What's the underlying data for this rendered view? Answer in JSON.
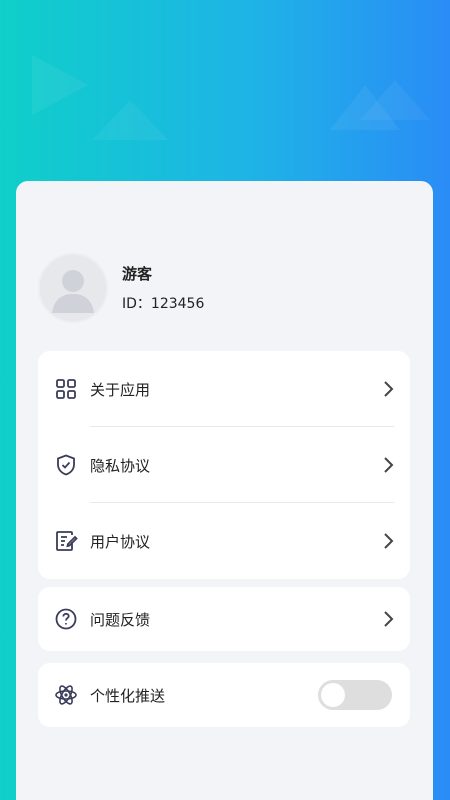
{
  "profile": {
    "name": "游客",
    "id_text": "ID：123456"
  },
  "menu": {
    "group1": [
      {
        "label": "关于应用",
        "icon": "grid-icon"
      },
      {
        "label": "隐私协议",
        "icon": "shield-check-icon"
      },
      {
        "label": "用户协议",
        "icon": "document-edit-icon"
      }
    ],
    "group2": [
      {
        "label": "问题反馈",
        "icon": "question-circle-icon"
      }
    ],
    "group3": [
      {
        "label": "个性化推送",
        "icon": "atom-icon",
        "toggle_on": false
      }
    ]
  },
  "colors": {
    "gradient_start": "#0fcfc9",
    "gradient_end": "#2a8cf6",
    "card_bg": "#f3f4f8",
    "icon_color": "#3a3c5a"
  }
}
